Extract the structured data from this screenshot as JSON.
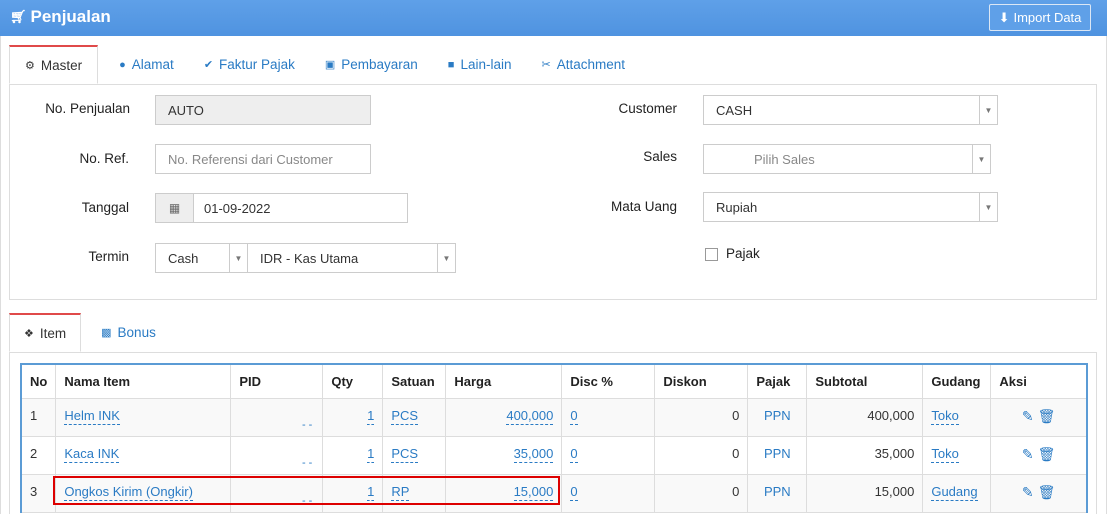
{
  "header": {
    "title": "Penjualan",
    "import_label": "Import Data"
  },
  "tabs": [
    {
      "label": "Master",
      "icon": "gears-icon"
    },
    {
      "label": "Alamat",
      "icon": "map-marker-icon"
    },
    {
      "label": "Faktur Pajak",
      "icon": "check-circle-icon"
    },
    {
      "label": "Pembayaran",
      "icon": "money-icon"
    },
    {
      "label": "Lain-lain",
      "icon": "truck-icon"
    },
    {
      "label": "Attachment",
      "icon": "paperclip-icon"
    }
  ],
  "form": {
    "no_penjualan_label": "No. Penjualan",
    "no_penjualan_value": "AUTO",
    "no_ref_label": "No. Ref.",
    "no_ref_placeholder": "No. Referensi dari Customer",
    "tanggal_label": "Tanggal",
    "tanggal_value": "01-09-2022",
    "termin_label": "Termin",
    "termin_value": "Cash",
    "kas_value": "IDR - Kas Utama",
    "customer_label": "Customer",
    "customer_value": "CASH",
    "sales_label": "Sales",
    "sales_placeholder": "Pilih Sales",
    "mata_uang_label": "Mata Uang",
    "mata_uang_value": "Rupiah",
    "pajak_label": "Pajak",
    "pajak_checked": false
  },
  "item_tabs": [
    {
      "label": "Item",
      "icon": "cubes-icon"
    },
    {
      "label": "Bonus",
      "icon": "gift-icon"
    }
  ],
  "table": {
    "headers": [
      "No",
      "Nama Item",
      "PID",
      "Qty",
      "Satuan",
      "Harga",
      "Disc %",
      "Diskon",
      "Pajak",
      "Subtotal",
      "Gudang",
      "Aksi"
    ],
    "rows": [
      {
        "no": "1",
        "nama": "Helm INK",
        "pid": "- -",
        "qty": "1",
        "satuan": "PCS",
        "harga": "400,000",
        "disc": "0",
        "diskon": "0",
        "pajak": "PPN",
        "subtotal": "400,000",
        "gudang": "Toko"
      },
      {
        "no": "2",
        "nama": "Kaca INK",
        "pid": "- -",
        "qty": "1",
        "satuan": "PCS",
        "harga": "35,000",
        "disc": "0",
        "diskon": "0",
        "pajak": "PPN",
        "subtotal": "35,000",
        "gudang": "Toko"
      },
      {
        "no": "3",
        "nama": "Ongkos Kirim (Ongkir)",
        "pid": "- -",
        "qty": "1",
        "satuan": "RP",
        "harga": "15,000",
        "disc": "0",
        "diskon": "0",
        "pajak": "PPN",
        "subtotal": "15,000",
        "gudang": "Gudang"
      }
    ]
  },
  "colors": {
    "header_bg": "#4f93e0",
    "link": "#2a7bc4",
    "active_tab_border": "#e04a4a",
    "highlight": "#dd0000"
  }
}
